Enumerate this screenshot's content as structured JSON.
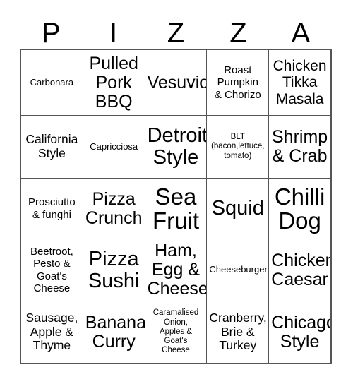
{
  "card": {
    "header_letters": [
      "P",
      "I",
      "Z",
      "Z",
      "A"
    ],
    "columns": 5,
    "rows": 5,
    "colors": {
      "background": "#ffffff",
      "text": "#000000",
      "grid_line": "#555555",
      "outer_border": "#555555"
    },
    "cells": [
      [
        {
          "text": "Carbonara",
          "size": "sm"
        },
        {
          "text": "Pulled\nPork\nBBQ",
          "size": "2xl"
        },
        {
          "text": "Vesuvio",
          "size": "2xl"
        },
        {
          "text": "Roast\nPumpkin\n& Chorizo",
          "size": "md"
        },
        {
          "text": "Chicken\nTikka\nMasala",
          "size": "xl"
        }
      ],
      [
        {
          "text": "California\nStyle",
          "size": "lg"
        },
        {
          "text": "Capricciosa",
          "size": "sm"
        },
        {
          "text": "Detroit\nStyle",
          "size": "3xl"
        },
        {
          "text": "BLT\n(bacon,lettuce,\ntomato)",
          "size": "xs"
        },
        {
          "text": "Shrimp\n& Crab",
          "size": "2xl"
        }
      ],
      [
        {
          "text": "Prosciutto\n& funghi",
          "size": "md"
        },
        {
          "text": "Pizza\nCrunch",
          "size": "2xl"
        },
        {
          "text": "Sea\nFruit",
          "size": "4xl"
        },
        {
          "text": "Squid",
          "size": "3xl"
        },
        {
          "text": "Chilli\nDog",
          "size": "4xl"
        }
      ],
      [
        {
          "text": "Beetroot,\nPesto &\nGoat's\nCheese",
          "size": "md"
        },
        {
          "text": "Pizza\nSushi",
          "size": "3xl"
        },
        {
          "text": "Ham,\nEgg &\nCheese",
          "size": "2xl"
        },
        {
          "text": "Cheeseburger",
          "size": "sm"
        },
        {
          "text": "Chicken\nCaesar",
          "size": "2xl"
        }
      ],
      [
        {
          "text": "Sausage,\nApple &\nThyme",
          "size": "lg"
        },
        {
          "text": "Banana\nCurry",
          "size": "2xl"
        },
        {
          "text": "Caramalised\nOnion,\nApples &\nGoat's\nCheese",
          "size": "xs"
        },
        {
          "text": "Cranberry,\nBrie &\nTurkey",
          "size": "lg"
        },
        {
          "text": "Chicago\nStyle",
          "size": "2xl"
        }
      ]
    ]
  }
}
